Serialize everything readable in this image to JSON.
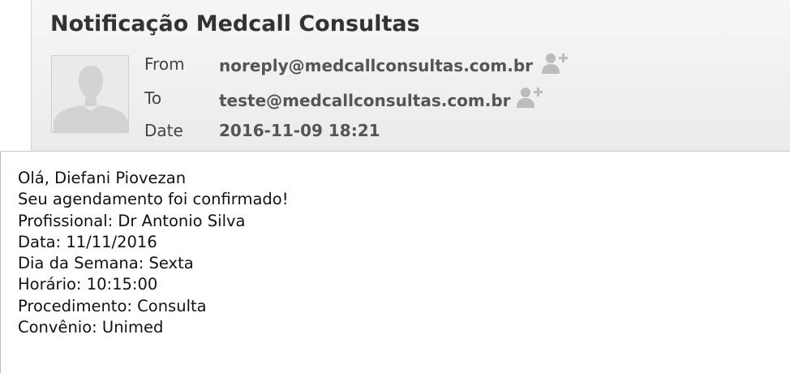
{
  "message": {
    "subject": "Notificação Medcall Consultas",
    "from_label": "From",
    "from_value": "noreply@medcallconsultas.com.br",
    "to_label": "To",
    "to_value": "teste@medcallconsultas.com.br",
    "date_label": "Date",
    "date_value": "2016-11-09 18:21"
  },
  "body": {
    "lines": [
      "Olá, Diefani Piovezan",
      "Seu agendamento foi confirmado!",
      "Profissional: Dr Antonio Silva",
      "Data: 11/11/2016",
      "Dia da Semana: Sexta",
      "Horário: 10:15:00",
      "Procedimento: Consulta",
      "Convênio: Unimed"
    ]
  },
  "icons": {
    "avatar": "person-silhouette-icon",
    "add_contact": "add-contact-icon"
  },
  "colors": {
    "header_background": "#f0f0f0",
    "label_text": "#444444",
    "value_text": "#555555",
    "icon_gray": "#bcbcbc"
  }
}
